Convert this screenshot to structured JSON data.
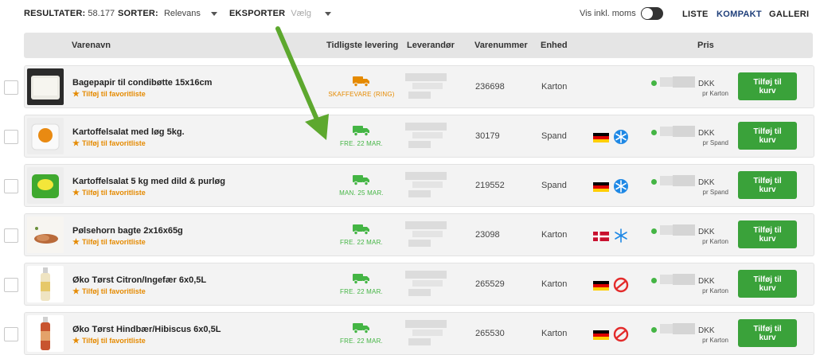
{
  "toolbar": {
    "results_label": "RESULTATER:",
    "results_count": "58.177",
    "sort_label": "SORTER:",
    "sort_value": "Relevans",
    "export_label": "EKSPORTER",
    "export_value": "Vælg",
    "vat_toggle_label": "Vis inkl. moms",
    "views": [
      "LISTE",
      "KOMPAKT",
      "GALLERI"
    ],
    "active_view": "KOMPAKT"
  },
  "table": {
    "columns": {
      "name": "Varenavn",
      "delivery": "Tidligste levering",
      "supplier": "Leverandør",
      "item_no": "Varenummer",
      "unit": "Enhed",
      "price": "Pris"
    },
    "favorite_label": "Tilføj til favoritliste",
    "add_label": "Tilføj til kurv",
    "currency": "DKK",
    "rows": [
      {
        "name": "Bagepapir til condibøtte 15x16cm",
        "delivery": "SKAFFEVARE (RING)",
        "delivery_color": "#e58a00",
        "item_no": "236698",
        "unit": "Karton",
        "price_unit": "pr Karton",
        "flag": "",
        "symbol": "",
        "thumb": "paper"
      },
      {
        "name": "Kartoffelsalat med løg 5kg.",
        "delivery": "FRE. 22 MAR.",
        "delivery_color": "#44b544",
        "item_no": "30179",
        "unit": "Spand",
        "price_unit": "pr Spand",
        "flag": "germany",
        "symbol": "frozen",
        "thumb": "bucket-orange"
      },
      {
        "name": "Kartoffelsalat 5 kg med dild & purløg",
        "delivery": "MAN. 25 MAR.",
        "delivery_color": "#44b544",
        "item_no": "219552",
        "unit": "Spand",
        "price_unit": "pr Spand",
        "flag": "germany",
        "symbol": "frozen",
        "thumb": "bucket-green"
      },
      {
        "name": "Pølsehorn bagte 2x16x65g",
        "delivery": "FRE. 22 MAR.",
        "delivery_color": "#44b544",
        "item_no": "23098",
        "unit": "Karton",
        "price_unit": "pr Karton",
        "flag": "denmark",
        "symbol": "snowflake",
        "thumb": "pastry"
      },
      {
        "name": "Øko Tørst Citron/Ingefær 6x0,5L",
        "delivery": "FRE. 22 MAR.",
        "delivery_color": "#44b544",
        "item_no": "265529",
        "unit": "Karton",
        "price_unit": "pr Karton",
        "flag": "germany",
        "symbol": "organic",
        "thumb": "bottle-light"
      },
      {
        "name": "Øko Tørst Hindbær/Hibiscus 6x0,5L",
        "delivery": "FRE. 22 MAR.",
        "delivery_color": "#44b544",
        "item_no": "265530",
        "unit": "Karton",
        "price_unit": "pr Karton",
        "flag": "germany",
        "symbol": "organic",
        "thumb": "bottle-red"
      }
    ]
  }
}
